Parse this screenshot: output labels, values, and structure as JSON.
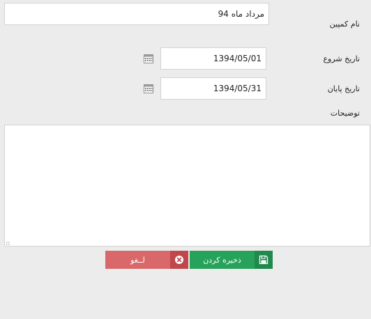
{
  "form": {
    "campaign_name_label": "نام کمپین",
    "campaign_name_value": "مرداد ماه 94",
    "start_date_label": "تاریخ شروع",
    "start_date_value": "1394/05/01",
    "end_date_label": "تاریخ پایان",
    "end_date_value": "1394/05/31",
    "description_label": "توضیحات",
    "description_value": ""
  },
  "buttons": {
    "save_label": "ذخیره کردن",
    "cancel_label": "لــغو"
  },
  "icons": {
    "calendar": "calendar-icon",
    "save": "floppy-disk-icon",
    "cancel": "close-circle-icon"
  },
  "colors": {
    "save_button": "#27a25a",
    "save_icon_bg": "#1f8a4b",
    "cancel_button": "#d9686a",
    "cancel_icon_bg": "#c0474a",
    "background": "#ececec"
  }
}
